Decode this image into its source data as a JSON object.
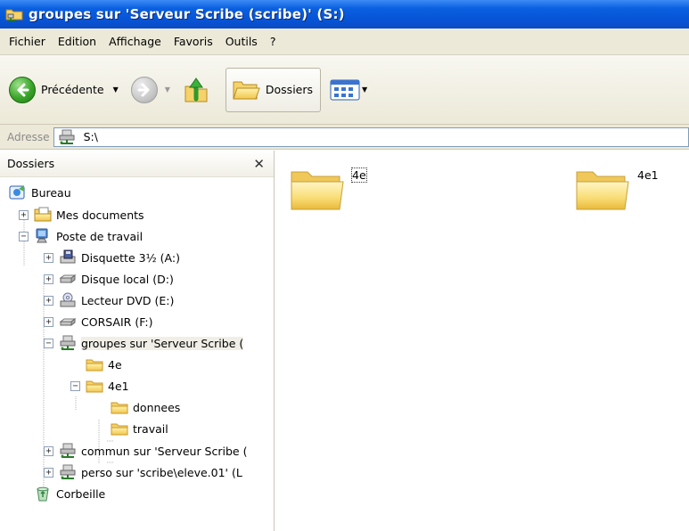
{
  "window": {
    "title": "groupes sur 'Serveur Scribe (scribe)' (S:)"
  },
  "menu": {
    "items": [
      "Fichier",
      "Edition",
      "Affichage",
      "Favoris",
      "Outils",
      "?"
    ]
  },
  "toolbar": {
    "back_label": "Précédente",
    "folders_label": "Dossiers"
  },
  "address": {
    "label": "Adresse",
    "value": "S:\\"
  },
  "folders_pane": {
    "title": "Dossiers",
    "tree": [
      {
        "label": "Bureau",
        "icon": "desktop-icon"
      },
      {
        "label": "Mes documents",
        "icon": "my-documents-icon"
      },
      {
        "label": "Poste de travail",
        "icon": "my-computer-icon"
      },
      {
        "label": "Disquette 3½ (A:)",
        "icon": "floppy-drive-icon"
      },
      {
        "label": "Disque local (D:)",
        "icon": "hard-drive-icon"
      },
      {
        "label": "Lecteur DVD (E:)",
        "icon": "dvd-drive-icon"
      },
      {
        "label": "CORSAIR (F:)",
        "icon": "removable-drive-icon"
      },
      {
        "label": "groupes sur 'Serveur Scribe (",
        "icon": "network-drive-icon"
      },
      {
        "label": "4e",
        "icon": "folder-icon"
      },
      {
        "label": "4e1",
        "icon": "folder-icon"
      },
      {
        "label": "donnees",
        "icon": "folder-icon"
      },
      {
        "label": "travail",
        "icon": "folder-icon"
      },
      {
        "label": "commun sur 'Serveur Scribe (",
        "icon": "network-drive-icon"
      },
      {
        "label": "perso sur 'scribe\\eleve.01' (L",
        "icon": "network-drive-icon"
      },
      {
        "label": "Corbeille",
        "icon": "recycle-bin-icon"
      }
    ]
  },
  "content": {
    "items": [
      {
        "label": "4e",
        "icon": "folder-icon"
      },
      {
        "label": "4e1",
        "icon": "folder-icon"
      }
    ]
  }
}
